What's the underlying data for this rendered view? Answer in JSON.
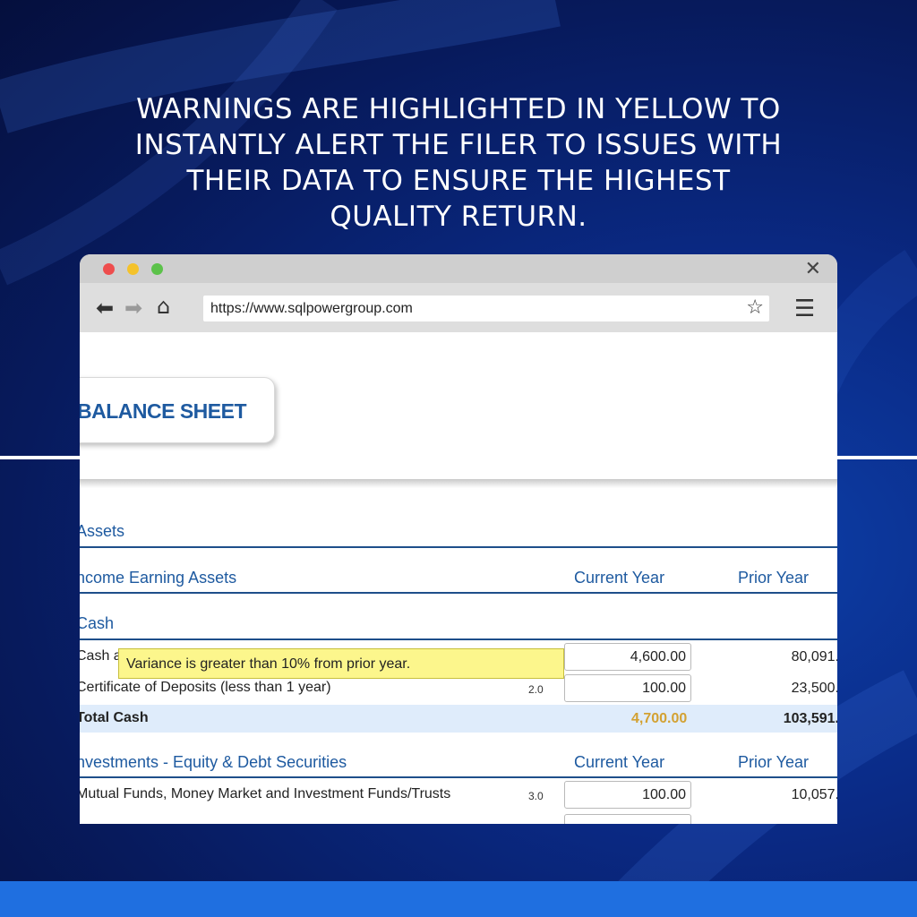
{
  "headline": "WARNINGS ARE HIGHLIGHTED IN YELLOW TO INSTANTLY ALERT THE FILER TO ISSUES WITH THEIR DATA TO ENSURE THE HIGHEST QUALITY RETURN.",
  "browser": {
    "url": "https://www.sqlpowergroup.com",
    "icons": [
      "close-icon",
      "back-arrow-icon",
      "forward-arrow-icon",
      "home-icon",
      "star-icon",
      "menu-icon"
    ]
  },
  "page": {
    "title": "BALANCE SHEET",
    "assets_label": "Assets",
    "income_section": {
      "label": "ncome Earning Assets",
      "col_current": "Current Year",
      "col_prior": "Prior Year"
    },
    "cash_label": "Cash",
    "rows": [
      {
        "label": "Cash a",
        "code": "",
        "current": "4,600.00",
        "prior": "80,091."
      },
      {
        "label": "Certificate of Deposits (less than 1 year)",
        "code": "2.0",
        "current": "100.00",
        "prior": "23,500."
      }
    ],
    "warning": "Variance is greater than 10% from prior year.",
    "total": {
      "label": "Total Cash",
      "current": "4,700.00",
      "prior": "103,591."
    },
    "investments_section": {
      "label": "nvestments - Equity & Debt Securities",
      "col_current": "Current Year",
      "col_prior": "Prior Year"
    },
    "inv_rows": [
      {
        "label": "Mutual Funds, Money Market and Investment Funds/Trusts",
        "code": "3.0",
        "current": "100.00",
        "prior": "10,057."
      }
    ]
  },
  "colors": {
    "warning_bg": "#fcf68c",
    "heading_blue": "#1e5aa0",
    "total_current": "#d3a132",
    "bottom_bar": "#1f6fe0"
  }
}
